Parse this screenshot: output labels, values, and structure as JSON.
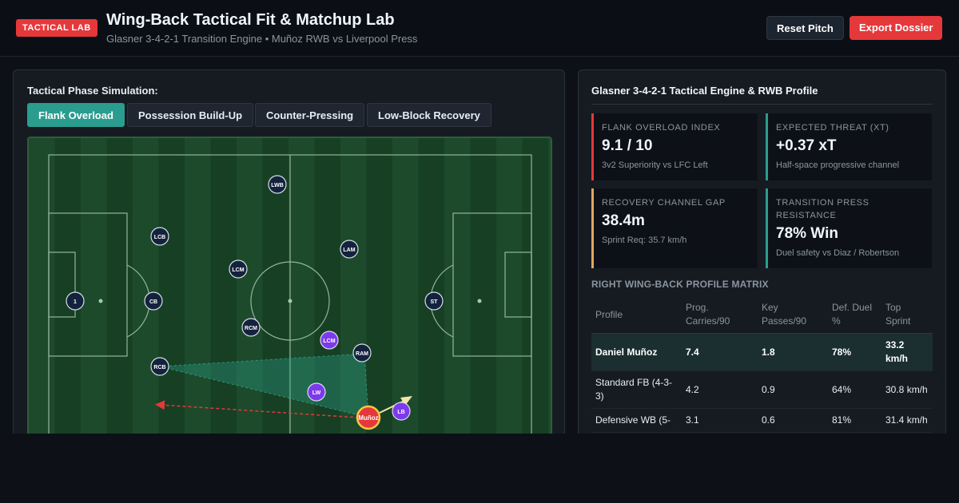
{
  "header": {
    "badge": "TACTICAL LAB",
    "title": "Wing-Back Tactical Fit & Matchup Lab",
    "subtitle": "Glasner 3-4-2-1 Transition Engine • Muñoz RWB vs Liverpool Press",
    "reset_label": "Reset Pitch",
    "export_label": "Export Dossier"
  },
  "simulation": {
    "label": "Tactical Phase Simulation:",
    "tabs": [
      {
        "label": "Flank Overload",
        "active": true
      },
      {
        "label": "Possession Build-Up",
        "active": false
      },
      {
        "label": "Counter-Pressing",
        "active": false
      },
      {
        "label": "Low-Block Recovery",
        "active": false
      }
    ]
  },
  "pitch": {
    "players": [
      {
        "label": "1",
        "team": "home"
      },
      {
        "label": "LCB",
        "team": "home"
      },
      {
        "label": "CB",
        "team": "home"
      },
      {
        "label": "RCB",
        "team": "home"
      },
      {
        "label": "LWB",
        "team": "home"
      },
      {
        "label": "LCM",
        "team": "home"
      },
      {
        "label": "RCM",
        "team": "home"
      },
      {
        "label": "LAM",
        "team": "home"
      },
      {
        "label": "RAM",
        "team": "home"
      },
      {
        "label": "ST",
        "team": "home"
      },
      {
        "label": "LCM",
        "team": "away"
      },
      {
        "label": "LW",
        "team": "away"
      },
      {
        "label": "LB",
        "team": "away"
      },
      {
        "label": "Muñoz",
        "team": "focus"
      }
    ]
  },
  "profile": {
    "title": "Glasner 3-4-2-1 Tactical Engine & RWB Profile",
    "cards": [
      {
        "label": "FLANK OVERLOAD INDEX",
        "value": "9.1 / 10",
        "sub": "3v2 Superiority vs LFC Left",
        "color": "#e5383b"
      },
      {
        "label": "EXPECTED THREAT (XT)",
        "value": "+0.37 xT",
        "sub": "Half-space progressive channel",
        "color": "#2a9d8f"
      },
      {
        "label": "RECOVERY CHANNEL GAP",
        "value": "38.4m",
        "sub": "Sprint Req: 35.7 km/h",
        "color": "#e0a85c"
      },
      {
        "label": "TRANSITION PRESS RESISTANCE",
        "value": "78% Win",
        "sub": "Duel safety vs Diaz / Robertson",
        "color": "#2a9d8f"
      }
    ],
    "matrix_label": "RIGHT WING-BACK PROFILE MATRIX",
    "columns": [
      "Profile",
      "Prog. Carries/90",
      "Key Passes/90",
      "Def. Duel %",
      "Top Sprint"
    ],
    "rows": [
      {
        "cells": [
          "Daniel Muñoz",
          "7.4",
          "1.8",
          "78%",
          "33.2 km/h"
        ],
        "highlight": true
      },
      {
        "cells": [
          "Standard FB (4-3-3)",
          "4.2",
          "0.9",
          "64%",
          "30.8 km/h"
        ],
        "highlight": false
      },
      {
        "cells": [
          "Defensive WB (5-",
          "3.1",
          "0.6",
          "81%",
          "31.4 km/h"
        ],
        "highlight": false
      }
    ]
  }
}
